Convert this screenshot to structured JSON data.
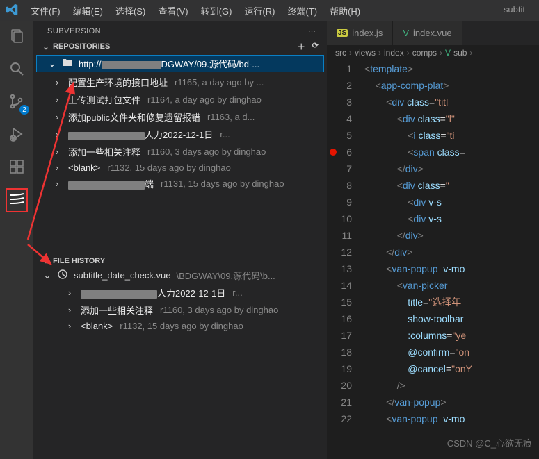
{
  "menubar": {
    "items": [
      "文件(F)",
      "编辑(E)",
      "选择(S)",
      "查看(V)",
      "转到(G)",
      "运行(R)",
      "终端(T)",
      "帮助(H)"
    ],
    "rightTitle": "subtit"
  },
  "activitybar": {
    "scmBadge": "2"
  },
  "sidebar": {
    "title": "SUBVERSION",
    "repositories": {
      "label": "REPOSITORIES",
      "repoUrlPrefix": "http://",
      "repoUrlSuffix": "DGWAY/09.源代码/bd-...",
      "commits": [
        {
          "msg": "配置生产环境的接口地址",
          "meta": "r1165, a day ago by ..."
        },
        {
          "msg": "上传测试打包文件",
          "meta": "r1164, a day ago by dinghao"
        },
        {
          "msg": "添加public文件夹和修复遗留报错",
          "meta": "r1163, a d..."
        },
        {
          "msg": "人力2022-12-1日",
          "meta": "r...",
          "redactedPrefix": true
        },
        {
          "msg": "添加一些相关注释",
          "meta": "r1160, 3 days ago by dinghao"
        },
        {
          "msg": "<blank>",
          "meta": "r1132, 15 days ago by dinghao"
        },
        {
          "msg": "端",
          "meta": "r1131, 15 days ago by dinghao",
          "redactedPrefix": true
        }
      ]
    },
    "fileHistory": {
      "label": "FILE HISTORY",
      "fileName": "subtitle_date_check.vue",
      "filePath": "\\BDGWAY\\09.源代码\\b...",
      "commits": [
        {
          "msg": "人力2022-12-1日",
          "meta": "r...",
          "redactedPrefix": true
        },
        {
          "msg": "添加一些相关注释",
          "meta": "r1160, 3 days ago by dinghao"
        },
        {
          "msg": "<blank>",
          "meta": "r1132, 15 days ago by dinghao"
        }
      ]
    }
  },
  "tabs": [
    {
      "name": "index.js",
      "icon": "JS",
      "type": "js"
    },
    {
      "name": "index.vue",
      "icon": "V",
      "type": "vue"
    }
  ],
  "breadcrumbs": [
    "src",
    "views",
    "index",
    "comps",
    "sub"
  ],
  "breadcrumbsLastIcon": "V",
  "gutter": {
    "lines": 22,
    "breakpointAt": 6
  },
  "code": [
    {
      "ind": 0,
      "html": "<span class='tok-tag'>&lt;</span><span class='tok-el'>template</span><span class='tok-tag'>&gt;</span>"
    },
    {
      "ind": 1,
      "html": "<span class='tok-tag'>&lt;</span><span class='tok-el'>app-comp-plat</span><span class='tok-tag'>&gt;</span>"
    },
    {
      "ind": 2,
      "html": "<span class='tok-tag'>&lt;</span><span class='tok-el'>div</span> <span class='tok-attr'>class</span><span class='tok-punct'>=</span><span class='tok-str'>\"titl</span>"
    },
    {
      "ind": 3,
      "html": "<span class='tok-tag'>&lt;</span><span class='tok-el'>div</span> <span class='tok-attr'>class</span><span class='tok-punct'>=</span><span class='tok-str'>\"l\"</span>"
    },
    {
      "ind": 4,
      "html": "<span class='tok-tag'>&lt;</span><span class='tok-el'>i</span> <span class='tok-attr'>class</span><span class='tok-punct'>=</span><span class='tok-str'>\"ti</span>"
    },
    {
      "ind": 4,
      "html": "<span class='tok-tag'>&lt;</span><span class='tok-el'>span</span> <span class='tok-attr'>class</span><span class='tok-punct'>=</span>"
    },
    {
      "ind": 3,
      "html": "<span class='tok-tag'>&lt;/</span><span class='tok-el'>div</span><span class='tok-tag'>&gt;</span>"
    },
    {
      "ind": 3,
      "html": "<span class='tok-tag'>&lt;</span><span class='tok-el'>div</span> <span class='tok-attr'>class</span><span class='tok-punct'>=</span><span class='tok-str'>\"</span>"
    },
    {
      "ind": 4,
      "html": "<span class='tok-tag'>&lt;</span><span class='tok-el'>div</span> <span class='tok-attr'>v-s</span>"
    },
    {
      "ind": 4,
      "html": "<span class='tok-tag'>&lt;</span><span class='tok-el'>div</span> <span class='tok-attr'>v-s</span>"
    },
    {
      "ind": 3,
      "html": "<span class='tok-tag'>&lt;/</span><span class='tok-el'>div</span><span class='tok-tag'>&gt;</span>"
    },
    {
      "ind": 2,
      "html": "<span class='tok-tag'>&lt;/</span><span class='tok-el'>div</span><span class='tok-tag'>&gt;</span>"
    },
    {
      "ind": 2,
      "html": "<span class='tok-tag'>&lt;</span><span class='tok-el'>van-popup</span>  <span class='tok-attr'>v-mo</span>"
    },
    {
      "ind": 3,
      "html": "<span class='tok-tag'>&lt;</span><span class='tok-el'>van-picker</span>"
    },
    {
      "ind": 4,
      "html": "<span class='tok-attr'>title</span><span class='tok-punct'>=</span><span class='tok-str'>\"选择年</span>"
    },
    {
      "ind": 4,
      "html": "<span class='tok-attr'>show-toolbar</span>"
    },
    {
      "ind": 4,
      "html": "<span class='tok-attr'>:columns</span><span class='tok-punct'>=</span><span class='tok-str'>\"ye</span>"
    },
    {
      "ind": 4,
      "html": "<span class='tok-attr'>@confirm</span><span class='tok-punct'>=</span><span class='tok-str'>\"on</span>"
    },
    {
      "ind": 4,
      "html": "<span class='tok-attr'>@cancel</span><span class='tok-punct'>=</span><span class='tok-str'>\"onY</span>"
    },
    {
      "ind": 3,
      "html": "<span class='tok-tag'>/&gt;</span>"
    },
    {
      "ind": 2,
      "html": "<span class='tok-tag'>&lt;/</span><span class='tok-el'>van-popup</span><span class='tok-tag'>&gt;</span>"
    },
    {
      "ind": 2,
      "html": "<span class='tok-tag'>&lt;</span><span class='tok-el'>van-popup</span>  <span class='tok-attr'>v-mo</span>"
    }
  ],
  "watermark": "CSDN @C_心欲无痕"
}
